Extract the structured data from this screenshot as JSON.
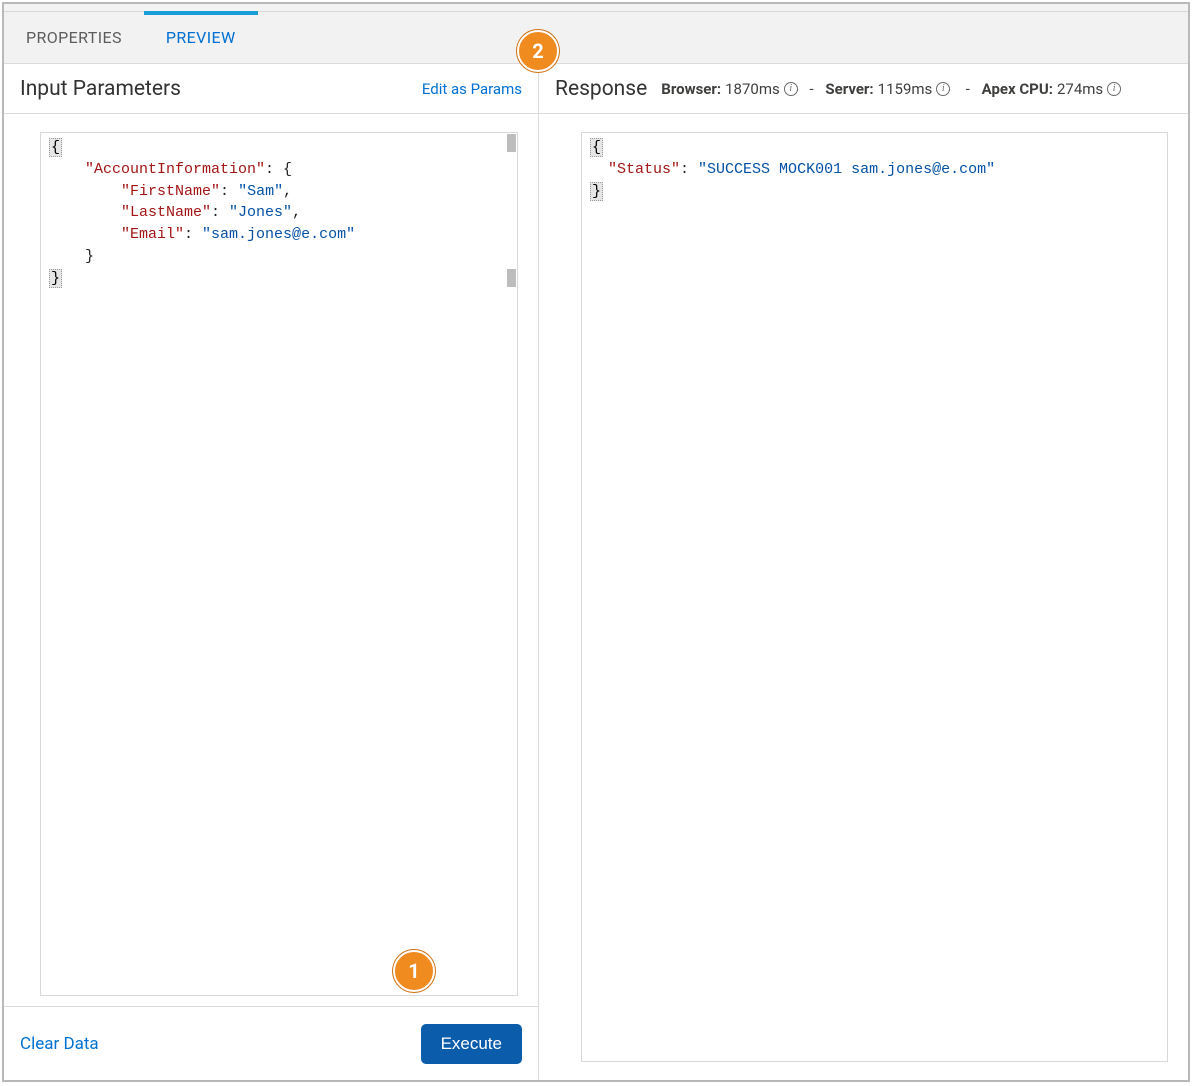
{
  "tabs": {
    "properties": "PROPERTIES",
    "preview": "PREVIEW"
  },
  "left": {
    "title": "Input Parameters",
    "edit_link": "Edit as Params",
    "clear": "Clear Data",
    "execute": "Execute",
    "json": {
      "rootKey": "AccountInformation",
      "fields": {
        "FirstName": "Sam",
        "LastName": "Jones",
        "Email": "sam.jones@e.com"
      }
    }
  },
  "right": {
    "title": "Response",
    "metrics": {
      "browser_label": "Browser:",
      "browser_value": "1870ms",
      "server_label": "Server:",
      "server_value": "1159ms",
      "apex_label": "Apex CPU:",
      "apex_value": "274ms",
      "separator": "-"
    },
    "json": {
      "Status": "SUCCESS MOCK001 sam.jones@e.com"
    }
  },
  "callouts": {
    "one": "1",
    "two": "2"
  },
  "icons": {
    "info": "i"
  }
}
